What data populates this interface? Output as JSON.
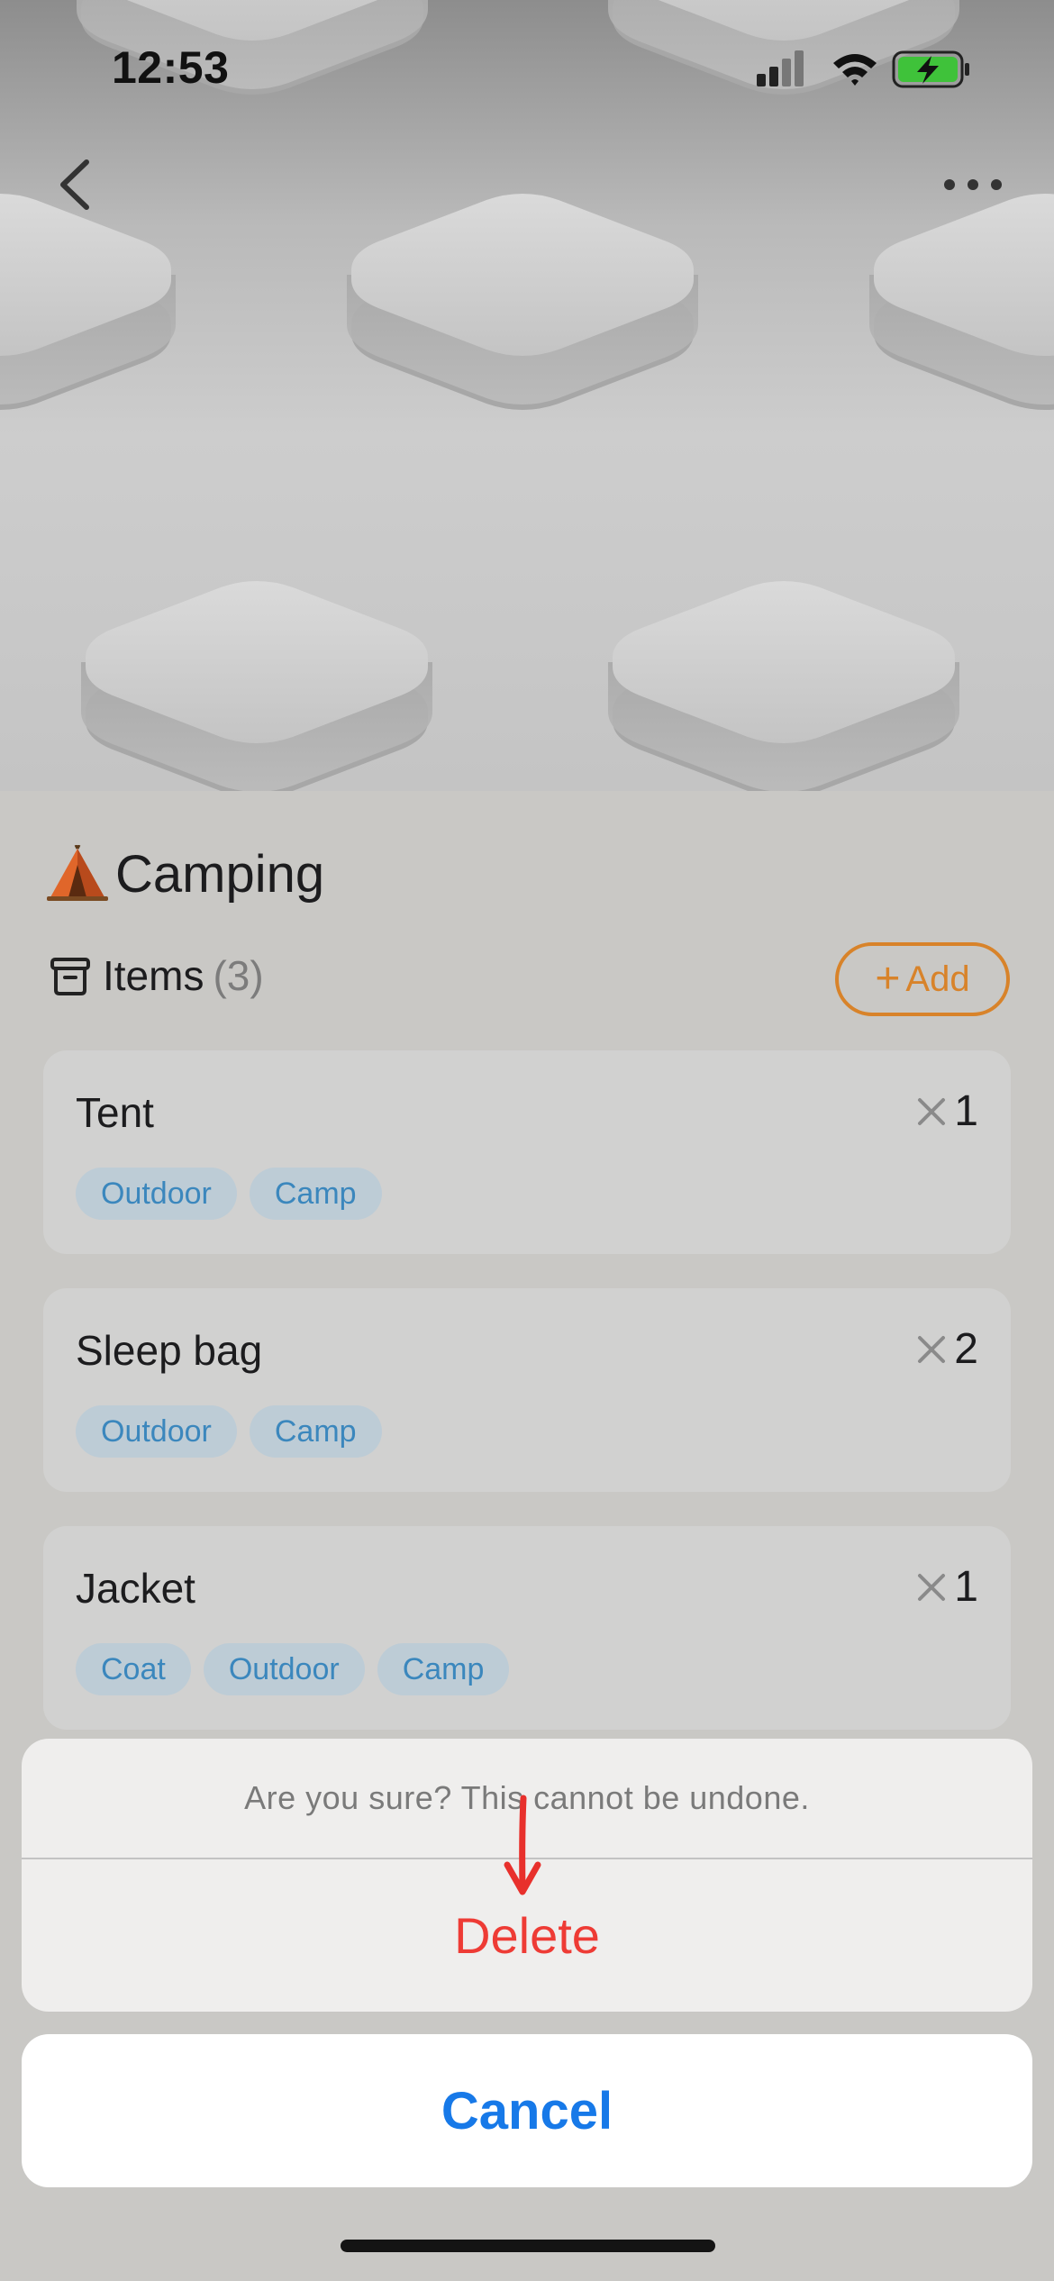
{
  "status_bar": {
    "time": "12:53"
  },
  "list": {
    "title": "Camping",
    "title_emoji_icon": "tent-icon",
    "items_label": "Items",
    "items_count": "(3)",
    "add_button": {
      "plus": "+",
      "label": "Add"
    },
    "items": [
      {
        "name": "Tent",
        "multiplier": "×",
        "quantity": "1",
        "tags": [
          "Outdoor",
          "Camp"
        ]
      },
      {
        "name": "Sleep bag",
        "multiplier": "×",
        "quantity": "2",
        "tags": [
          "Outdoor",
          "Camp"
        ]
      },
      {
        "name": "Jacket",
        "multiplier": "×",
        "quantity": "1",
        "tags": [
          "Coat",
          "Outdoor",
          "Camp"
        ]
      }
    ]
  },
  "action_sheet": {
    "message": "Are you sure? This cannot be undone.",
    "delete_label": "Delete",
    "cancel_label": "Cancel"
  },
  "colors": {
    "accent_orange": "#d8832a",
    "destructive_red": "#ee3b35",
    "cancel_blue": "#1779e8",
    "tag_blue": "#3b87bd"
  }
}
